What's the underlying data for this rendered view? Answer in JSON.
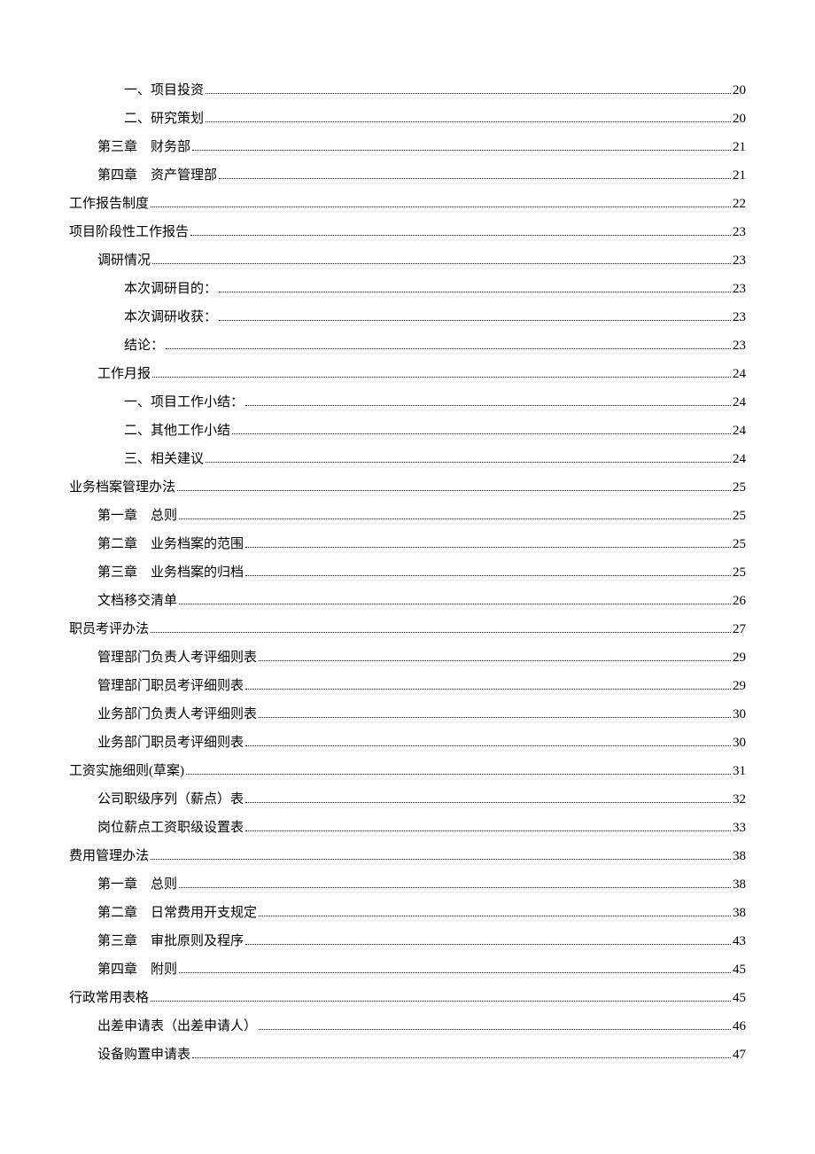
{
  "toc": [
    {
      "level": 2,
      "label": "一、项目投资",
      "page": "20"
    },
    {
      "level": 2,
      "label": "二、研究策划",
      "page": "20"
    },
    {
      "level": 1,
      "label": "第三章　财务部",
      "page": "21"
    },
    {
      "level": 1,
      "label": "第四章　资产管理部",
      "page": "21"
    },
    {
      "level": 0,
      "label": "工作报告制度",
      "page": "22"
    },
    {
      "level": 0,
      "label": "项目阶段性工作报告",
      "page": "23"
    },
    {
      "level": 1,
      "label": "调研情况",
      "page": "23"
    },
    {
      "level": 2,
      "label": "本次调研目的：",
      "page": "23"
    },
    {
      "level": 2,
      "label": "本次调研收获：",
      "page": "23"
    },
    {
      "level": 2,
      "label": "结论：",
      "page": "23"
    },
    {
      "level": 1,
      "label": "工作月报",
      "page": "24"
    },
    {
      "level": 2,
      "label": "一、项目工作小结：",
      "page": "24"
    },
    {
      "level": 2,
      "label": "二、其他工作小结",
      "page": "24"
    },
    {
      "level": 2,
      "label": "三、相关建议",
      "page": "24"
    },
    {
      "level": 0,
      "label": "业务档案管理办法",
      "page": "25"
    },
    {
      "level": 1,
      "label": "第一章　总则",
      "page": "25"
    },
    {
      "level": 1,
      "label": "第二章　业务档案的范围",
      "page": "25"
    },
    {
      "level": 1,
      "label": "第三章　业务档案的归档",
      "page": "25"
    },
    {
      "level": 1,
      "label": "文档移交清单",
      "page": "26"
    },
    {
      "level": 0,
      "label": "职员考评办法",
      "page": "27"
    },
    {
      "level": 1,
      "label": "管理部门负责人考评细则表",
      "page": "29"
    },
    {
      "level": 1,
      "label": "管理部门职员考评细则表",
      "page": "29"
    },
    {
      "level": 1,
      "label": "业务部门负责人考评细则表",
      "page": "30"
    },
    {
      "level": 1,
      "label": "业务部门职员考评细则表",
      "page": "30"
    },
    {
      "level": 0,
      "label": "工资实施细则(草案)",
      "page": "31"
    },
    {
      "level": 1,
      "label": "公司职级序列（薪点）表",
      "page": "32"
    },
    {
      "level": 1,
      "label": "岗位薪点工资职级设置表",
      "page": "33"
    },
    {
      "level": 0,
      "label": "费用管理办法",
      "page": "38"
    },
    {
      "level": 1,
      "label": "第一章　总则",
      "page": "38"
    },
    {
      "level": 1,
      "label": "第二章　日常费用开支规定",
      "page": "38"
    },
    {
      "level": 1,
      "label": "第三章　审批原则及程序",
      "page": "43"
    },
    {
      "level": 1,
      "label": "第四章　附则",
      "page": "45"
    },
    {
      "level": 0,
      "label": "行政常用表格",
      "page": "45"
    },
    {
      "level": 1,
      "label": "出差申请表（出差申请人）",
      "page": "46"
    },
    {
      "level": 1,
      "label": "设备购置申请表",
      "page": "47"
    }
  ]
}
